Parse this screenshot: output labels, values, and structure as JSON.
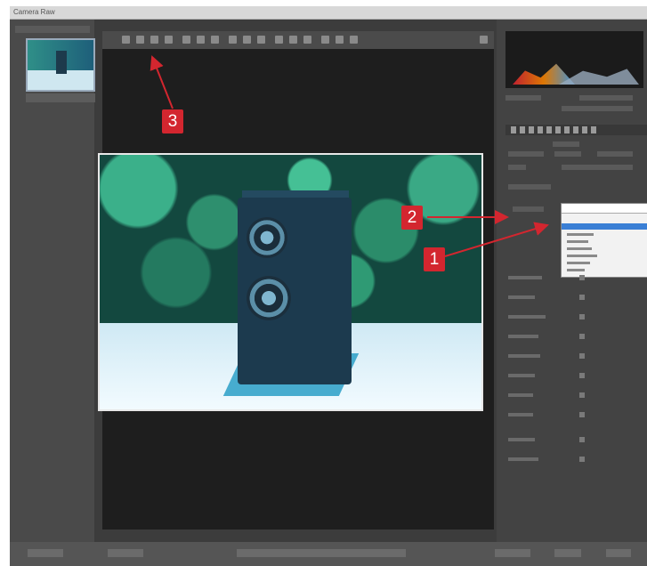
{
  "window": {
    "title": "Camera Raw"
  },
  "annotations": [
    {
      "number": "1",
      "target": "dropdown-menu"
    },
    {
      "number": "2",
      "target": "settings-dropdown"
    },
    {
      "number": "3",
      "target": "toolbar"
    }
  ],
  "colors": {
    "badge": "#d3262f",
    "arrow": "#d3262f",
    "selection": "#3a7fd5"
  }
}
